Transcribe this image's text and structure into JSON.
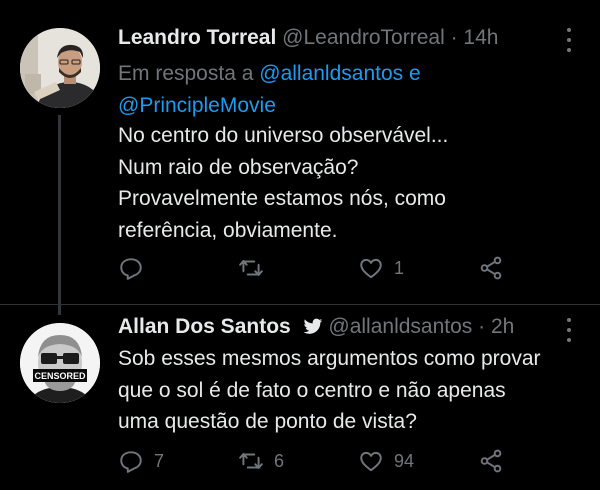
{
  "tweets": [
    {
      "name": "Leandro Torreal",
      "handle": "@LeandroTorreal",
      "separator": "·",
      "time": "14h",
      "reply_prefix": "Em resposta a",
      "reply_handle_1": "@allanldsantos",
      "reply_conj": "e",
      "reply_handle_2": "@PrincipleMovie",
      "lines": [
        "No centro do universo observável...",
        "Num raio de observação?",
        "Provavelmente estamos nós, como",
        "referência, obviamente."
      ],
      "actions": {
        "reply_count": "",
        "retweet_count": "",
        "like_count": "1"
      },
      "icons": [
        "reply-icon",
        "retweet-icon",
        "like-icon",
        "share-icon"
      ]
    },
    {
      "name": "Allan Dos Santos",
      "verified_icon": "twitter-bird-icon",
      "handle": "@allanldsantos",
      "separator": "·",
      "time": "2h",
      "lines": [
        "Sob esses mesmos argumentos como provar",
        "que o sol é de fato o centro e não apenas",
        "uma questão de ponto de vista?"
      ],
      "avatar_label": "CENSORED",
      "actions": {
        "reply_count": "7",
        "retweet_count": "6",
        "like_count": "94"
      },
      "icons": [
        "reply-icon",
        "retweet-icon",
        "like-icon",
        "share-icon"
      ]
    }
  ],
  "colors": {
    "background": "#000000",
    "text": "#e7e9ea",
    "muted": "#71767b",
    "link": "#1d9bf0"
  }
}
